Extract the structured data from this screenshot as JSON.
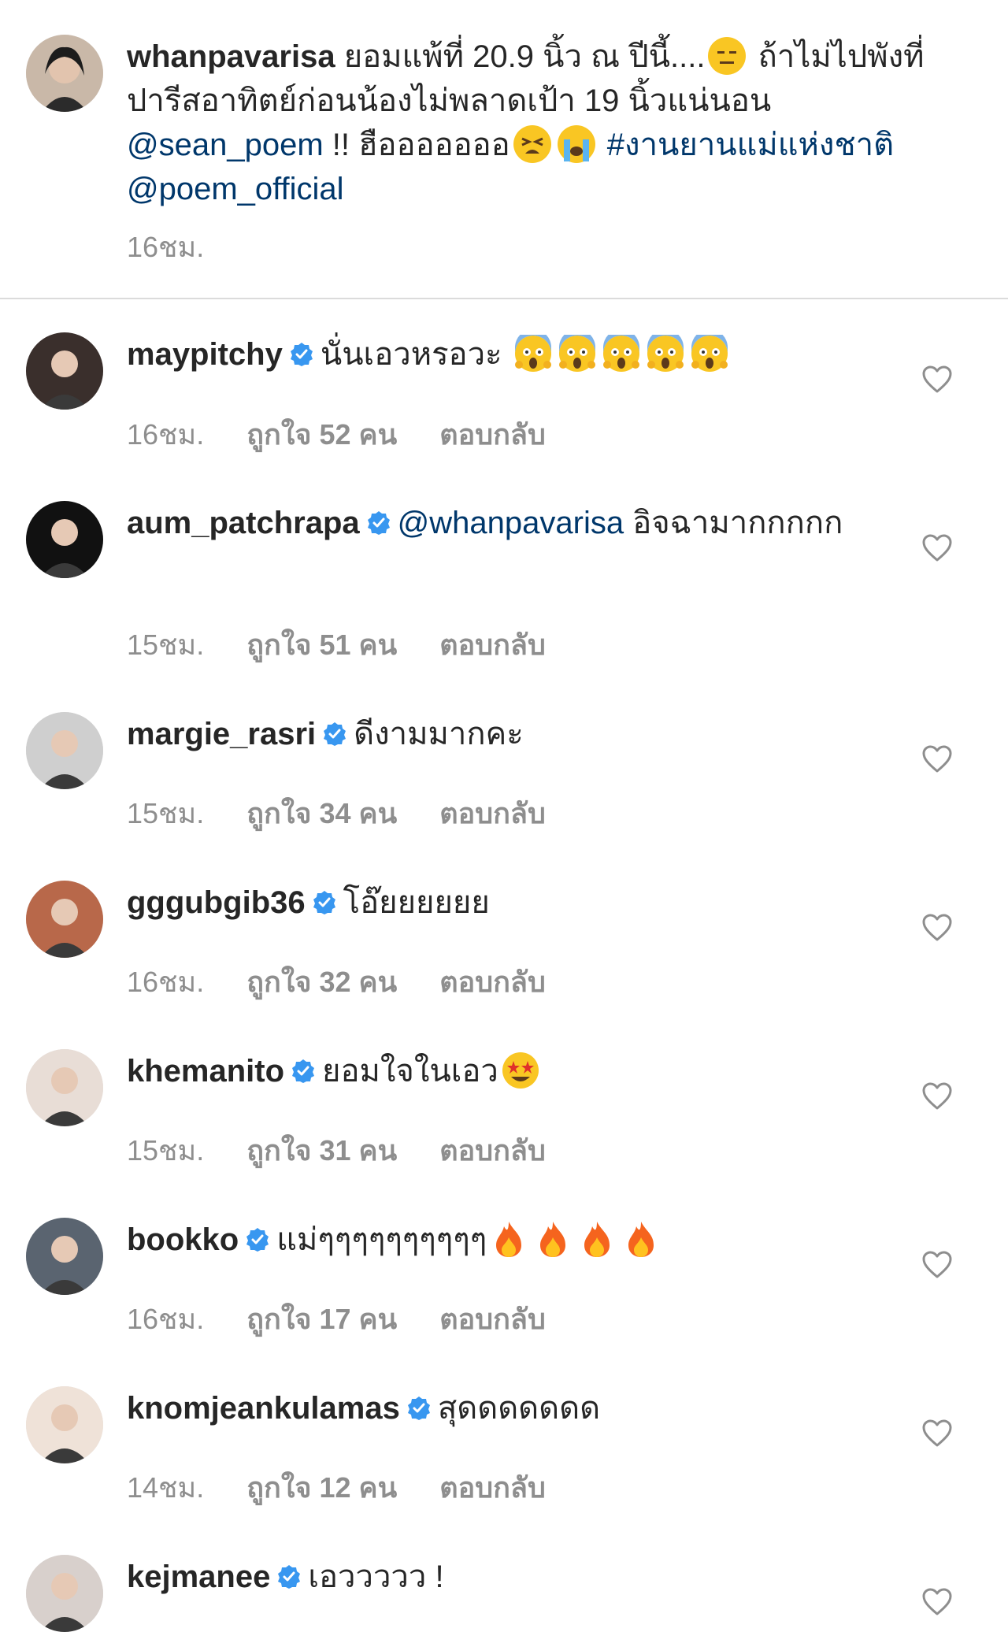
{
  "caption": {
    "username": "whanpavarisa",
    "text_1": " ยอมแพ้ที่ 20.9 นิ้ว ณ ปีนี้....",
    "emoji_1": "expressionless-face",
    "text_2": " ถ้าไม่ไปพังที่ปารีสอาทิตย์ก่อนน้องไม่พลาดเป้า 19 นิ้วแน่นอน ",
    "mention_1": "@sean_poem",
    "text_3": " !! ฮือออออออ",
    "emoji_2": "tired-face",
    "emoji_3": "loudly-crying-face",
    "hashtag": " #งานยานแม่แห่งชาติ",
    "mention_2": "@poem_official",
    "time": "16ชม."
  },
  "comments": [
    {
      "username": "maypitchy",
      "text": "นั่นเอวหรอวะ ",
      "emoji": [
        "scream",
        "scream",
        "scream",
        "scream",
        "scream"
      ],
      "time": "16ชม.",
      "likes": "ถูกใจ 52 คน",
      "reply": "ตอบกลับ"
    },
    {
      "username": "aum_patchrapa",
      "mention": "@whanpavarisa",
      "text": " อิจฉามากกกกก",
      "time": "15ชม.",
      "likes": "ถูกใจ 51 คน",
      "reply": "ตอบกลับ"
    },
    {
      "username": "margie_rasri",
      "text": "ดีงามมากคะ",
      "time": "15ชม.",
      "likes": "ถูกใจ 34 คน",
      "reply": "ตอบกลับ"
    },
    {
      "username": "gggubgib36",
      "text": "โอ๊ยยยยยย",
      "time": "16ชม.",
      "likes": "ถูกใจ 32 คน",
      "reply": "ตอบกลับ"
    },
    {
      "username": "khemanito",
      "text": "ยอมใจในเอว",
      "emoji": [
        "star-struck"
      ],
      "time": "15ชม.",
      "likes": "ถูกใจ 31 คน",
      "reply": "ตอบกลับ"
    },
    {
      "username": "bookko",
      "text": "แม่ๆๆๆๆๆๆๆๆๆๆ",
      "emoji": [
        "fire",
        "fire",
        "fire",
        "fire"
      ],
      "time": "16ชม.",
      "likes": "ถูกใจ 17 คน",
      "reply": "ตอบกลับ"
    },
    {
      "username": "knomjeankulamas",
      "text": "สุดดดดดดด",
      "time": "14ชม.",
      "likes": "ถูกใจ 12 คน",
      "reply": "ตอบกลับ"
    },
    {
      "username": "kejmanee",
      "text": "เอววววว !"
    }
  ],
  "colors": {
    "link": "#00376b",
    "verified": "#3897f0",
    "meta": "#8e8e8e",
    "divider": "#dbdbdb"
  }
}
